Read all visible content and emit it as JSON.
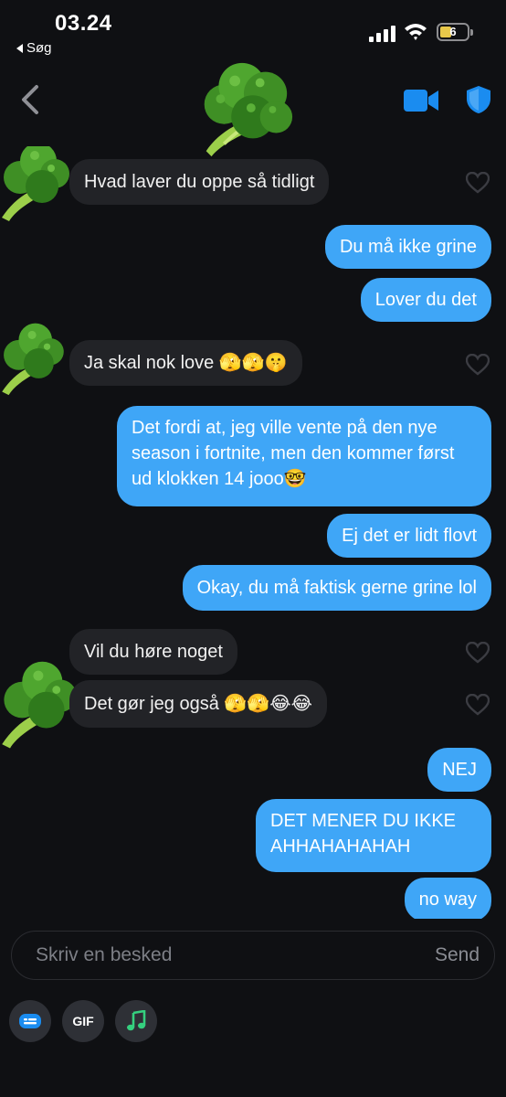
{
  "status": {
    "time": "03.24",
    "back_app": "Søg",
    "battery_level": "6"
  },
  "header": {
    "avatar_icon": "broccoli-emoji",
    "video_icon": "video-camera-icon",
    "shield_icon": "shield-icon"
  },
  "messages": [
    {
      "side": "in",
      "text": "Hvad laver du oppe så tidligt"
    },
    {
      "side": "out",
      "text": "Du må ikke grine"
    },
    {
      "side": "out",
      "text": "Lover du det"
    },
    {
      "side": "in",
      "text": "Ja skal nok love 🫣🫣🤫"
    },
    {
      "side": "out",
      "text": "Det fordi at, jeg ville vente på den nye season i fortnite, men den kommer først ud klokken 14 jooo🤓"
    },
    {
      "side": "out",
      "text": "Ej det er lidt flovt"
    },
    {
      "side": "out",
      "text": "Okay, du må faktisk gerne grine lol"
    },
    {
      "side": "in",
      "text": "Vil du høre noget"
    },
    {
      "side": "in",
      "text": "Det gør jeg også 🫣🫣😂😂"
    },
    {
      "side": "out",
      "text": "NEJ"
    },
    {
      "side": "out",
      "text": "DET MENER DU IKKE AHHAHAHAHAH"
    },
    {
      "side": "out",
      "text": "no way"
    }
  ],
  "composer": {
    "placeholder": "Skriv en besked",
    "send_label": "Send"
  },
  "toolbar": {
    "gif_label": "GIF"
  },
  "colors": {
    "outgoing_bubble": "#3fa6f7",
    "incoming_bubble": "#222327",
    "background": "#0f1013",
    "accent_icons": "#1a8cf0"
  }
}
